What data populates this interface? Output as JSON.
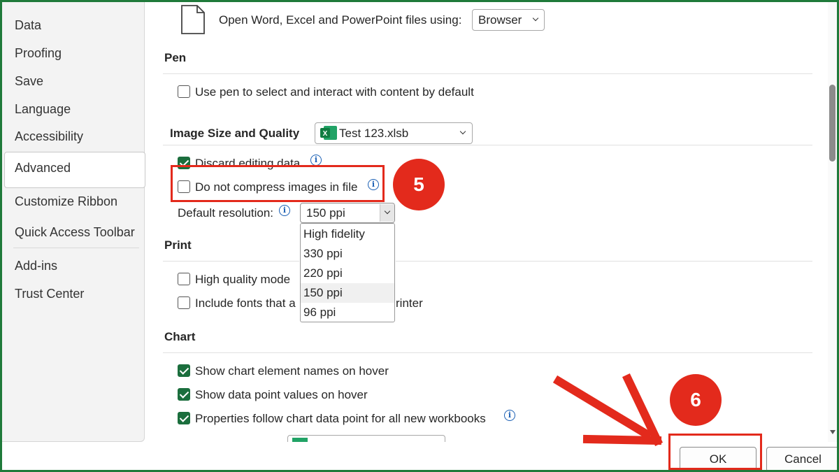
{
  "sidebar": {
    "items": [
      {
        "label": "Data"
      },
      {
        "label": "Proofing"
      },
      {
        "label": "Save"
      },
      {
        "label": "Language"
      },
      {
        "label": "Accessibility"
      },
      {
        "label": "Advanced",
        "selected": true
      },
      {
        "label": "Customize Ribbon"
      },
      {
        "label": "Quick Access Toolbar"
      },
      {
        "label": "Add-ins"
      },
      {
        "label": "Trust Center"
      }
    ]
  },
  "open_files": {
    "label": "Open Word, Excel and PowerPoint files using:",
    "value": "Browser"
  },
  "pen": {
    "title": "Pen",
    "option": {
      "label": "Use pen to select and interact with content by default",
      "checked": false
    }
  },
  "image_quality": {
    "title": "Image Size and Quality",
    "workbook": "Test 123.xlsb",
    "discard": {
      "label": "Discard editing data",
      "checked": true
    },
    "no_compress": {
      "label": "Do not compress images in file",
      "checked": false
    },
    "resolution_label": "Default resolution:",
    "resolution_value": "150 ppi",
    "resolution_options": [
      "High fidelity",
      "330 ppi",
      "220 ppi",
      "150 ppi",
      "96 ppi"
    ]
  },
  "print": {
    "title": "Print",
    "high_quality": {
      "label": "High quality mode",
      "checked": false
    },
    "include_fonts": {
      "label_start": "Include fonts that a",
      "label_end": "rinter",
      "checked": false
    }
  },
  "chart": {
    "title": "Chart",
    "names_hover": {
      "label": "Show chart element names on hover",
      "checked": true
    },
    "values_hover": {
      "label": "Show data point values on hover",
      "checked": true
    },
    "properties_follow": {
      "label": "Properties follow chart data point for all new workbooks",
      "checked": true
    }
  },
  "buttons": {
    "ok": "OK",
    "cancel": "Cancel"
  },
  "annotations": {
    "step5": "5",
    "step6": "6",
    "accent": "#e32a1c"
  },
  "colors": {
    "frame": "#1f7a3a",
    "checkbox": "#1b6e3d",
    "info": "#1a5fb4"
  }
}
